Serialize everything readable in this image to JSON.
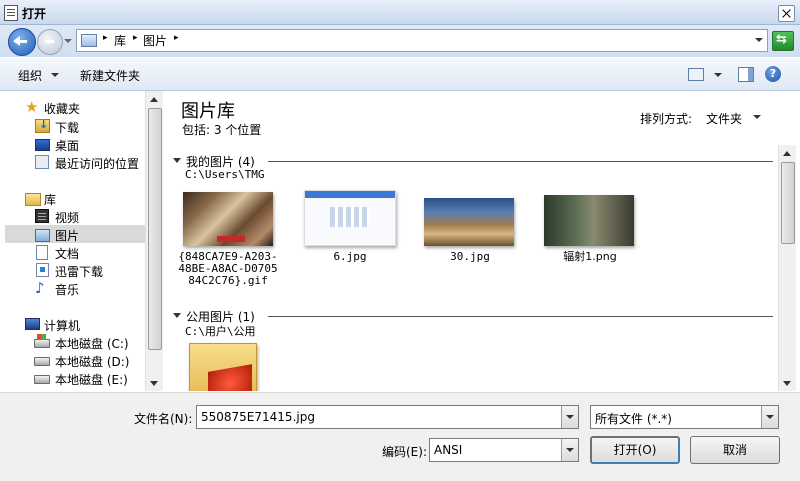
{
  "window": {
    "title": "打开"
  },
  "address": {
    "crumbs": [
      "库",
      "图片"
    ],
    "sep": "▸"
  },
  "toolbar": {
    "organize": "组织",
    "new_folder": "新建文件夹",
    "help": "?"
  },
  "nav": {
    "favorites": {
      "label": "收藏夹",
      "items": [
        "下载",
        "桌面",
        "最近访问的位置"
      ]
    },
    "libraries": {
      "label": "库",
      "items": [
        "视频",
        "图片",
        "文档",
        "迅雷下载",
        "音乐"
      ]
    },
    "computer": {
      "label": "计算机",
      "items": [
        "本地磁盘 (C:)",
        "本地磁盘 (D:)",
        "本地磁盘 (E:)"
      ]
    }
  },
  "library": {
    "title": "图片库",
    "includes": "包括: 3 个位置",
    "arrange_label": "排列方式:",
    "arrange_value": "文件夹"
  },
  "groups": [
    {
      "name": "我的图片 (4)",
      "path": "C:\\Users\\TMG",
      "files": [
        {
          "caption_lines": [
            "{848CA7E9-A203-",
            "48BE-A8AC-D0705",
            "84C2C76}.gif"
          ]
        },
        {
          "caption_lines": [
            "6.jpg"
          ]
        },
        {
          "caption_lines": [
            "30.jpg"
          ]
        },
        {
          "caption_lines": [
            "辐射1.png"
          ]
        }
      ]
    },
    {
      "name": "公用图片 (1)",
      "path": "C:\\用户\\公用"
    }
  ],
  "bottom": {
    "filename_label": "文件名(N):",
    "filename_value": "550875E71415.jpg",
    "filetype_value": "所有文件  (*.*)",
    "encoding_label": "编码(E):",
    "encoding_value": "ANSI",
    "open_label": "打开(O)",
    "cancel_label": "取消"
  },
  "colors": {
    "selection": "#d9d9d9",
    "titlebar": "#c9d9ee",
    "accent": "#1f5bb8"
  }
}
